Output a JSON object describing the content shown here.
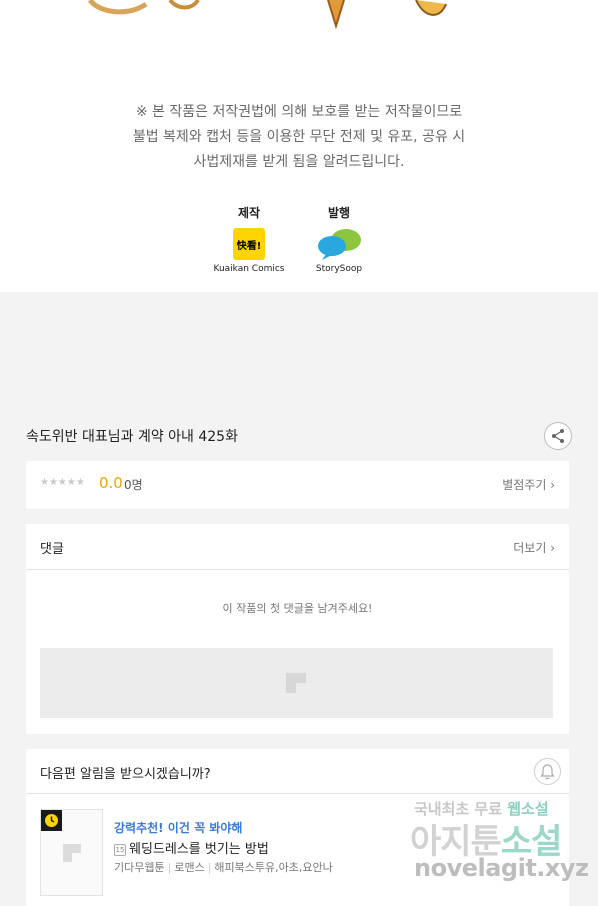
{
  "notice": {
    "line1": "※ 본 작품은 저작권법에 의해 보호를 받는 저작물이므로",
    "line2": "불법 복제와 캡처 등을  이용한 무단 전제 및 유포, 공유 시",
    "line3": "사법제재를  받게 됨을 알려드립니다."
  },
  "credits": {
    "production_label": "제작",
    "production_logo_text": "快看!",
    "production_name": "Kuaikan Comics",
    "publisher_label": "발행",
    "publisher_name": "StorySoop"
  },
  "episode": {
    "title": "속도위반 대표님과 계약 아내 425화"
  },
  "rating": {
    "stars": "★★★★★",
    "score": "0.0",
    "count": "0명",
    "rate_link": "별점주기 ›"
  },
  "comments": {
    "title": "댓글",
    "more": "더보기 ›",
    "empty_message": "이 작품의 첫 댓글을 남겨주세요!"
  },
  "next_episode": {
    "prompt": "다음편 알림을 받으시겠습니까?",
    "recommendation": {
      "tag": "강력추천! 이건 꼭 봐야해",
      "age_badge": "15",
      "title": "웨딩드레스를 벗기는 방법",
      "meta": [
        "기다무웹툰",
        "로맨스",
        "해피북스투유,아초,요안나"
      ]
    }
  },
  "watermark": {
    "line1_a": "국내최초 무료 ",
    "line1_b": "웹소설",
    "line2_a": "아지툰",
    "line2_b": "소설",
    "line3": "novelagit.xyz"
  },
  "colors": {
    "score": "#e6a800",
    "recommend_tag": "#3c7ad9",
    "kuaikan_yellow": "#ffd400",
    "background": "#f3f3f3"
  },
  "icons": {
    "share": "share-icon",
    "bell": "bell-icon",
    "clock": "clock-icon",
    "image_placeholder": "image-placeholder-icon"
  }
}
